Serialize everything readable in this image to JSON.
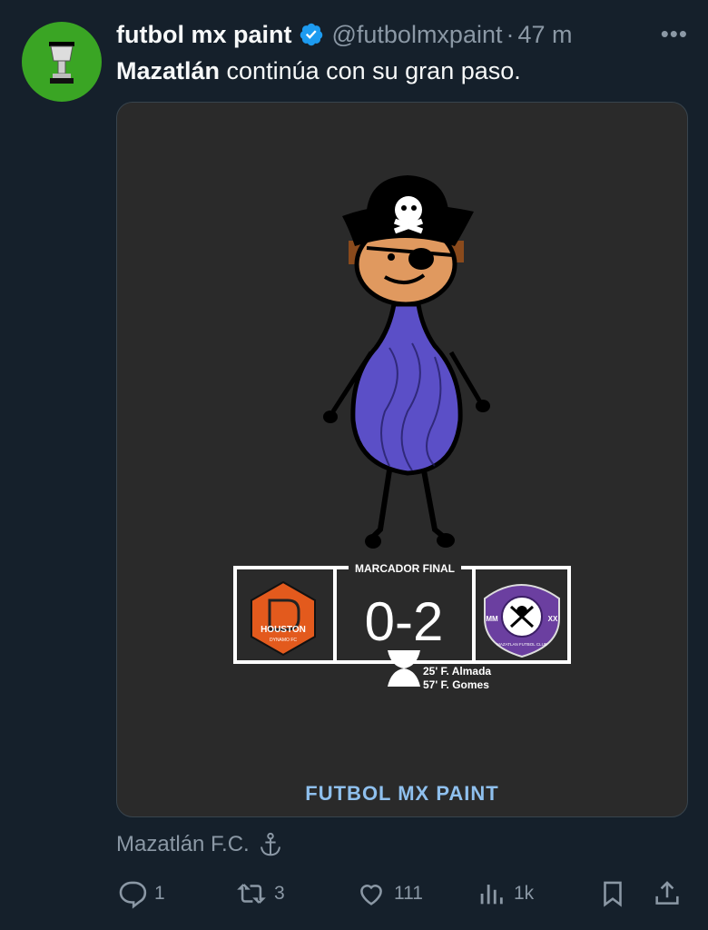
{
  "tweet": {
    "display_name": "futbol mx paint",
    "handle": "@futbolmxpaint",
    "separator": "·",
    "time": "47 m",
    "more_label": "•••",
    "text_bold": "Mazatlán",
    "text_rest": " continúa con su gran paso."
  },
  "media": {
    "scoreboard_title": "MARCADOR FINAL",
    "score": "0-2",
    "home_logo_text": "HOUSTON",
    "home_logo_subtext": "DYNAMO FC",
    "away_logo_left": "MM",
    "away_logo_right": "XX",
    "away_logo_text": "MAZATLAN FUTBOL CLUB",
    "scorers": [
      "25' F. Almada",
      "57' F. Gomes"
    ],
    "watermark": "FUTBOL MX PAINT"
  },
  "community": {
    "label": "Mazatlán F.C."
  },
  "actions": {
    "replies": "1",
    "reposts": "3",
    "likes": "111",
    "views": "1k"
  },
  "colors": {
    "background": "#15202b",
    "muted": "#8b98a5",
    "verified": "#1d9bf0",
    "avatar": "#3aa524",
    "media_bg": "#2a2a2a",
    "shirt": "#5b4fc7",
    "skin": "#e0995f",
    "houston_orange": "#e35a1d",
    "mazatlan_purple": "#6b3fa0",
    "watermark": "#8fc0ee"
  }
}
